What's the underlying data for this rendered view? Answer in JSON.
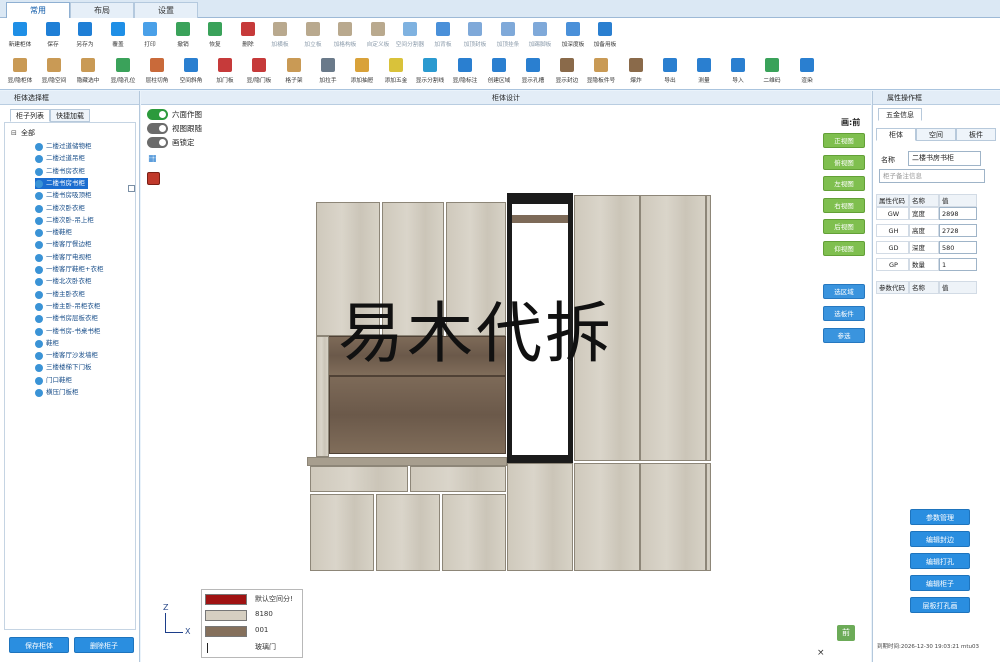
{
  "tabs": [
    "常用",
    "布局",
    "设置"
  ],
  "ribbon_row1": [
    {
      "label": "新建柜体",
      "color": "#1f8fe6",
      "dim": false
    },
    {
      "label": "保存",
      "color": "#1f7fd6",
      "dim": false
    },
    {
      "label": "另存为",
      "color": "#1f7fd6",
      "dim": false
    },
    {
      "label": "覆盖",
      "color": "#1f8fe6",
      "dim": false
    },
    {
      "label": "打印",
      "color": "#4aa0e8",
      "dim": false
    },
    {
      "label": "撤销",
      "color": "#3aa25a",
      "dim": false
    },
    {
      "label": "恢复",
      "color": "#3aa25a",
      "dim": false
    },
    {
      "label": "删除",
      "color": "#c63a3a",
      "dim": false
    },
    {
      "label": "加横板",
      "color": "#b9a98e",
      "dim": true
    },
    {
      "label": "加立板",
      "color": "#b9a98e",
      "dim": true
    },
    {
      "label": "加格构板",
      "color": "#b9a98e",
      "dim": true
    },
    {
      "label": "自定义板",
      "color": "#b9a98e",
      "dim": true
    },
    {
      "label": "空间分割器",
      "color": "#7fb2e0",
      "dim": true
    },
    {
      "label": "加背板",
      "color": "#4a90d9",
      "dim": true
    },
    {
      "label": "加顶封板",
      "color": "#7fa9d9",
      "dim": true
    },
    {
      "label": "加顶挂条",
      "color": "#7fa9d9",
      "dim": true
    },
    {
      "label": "加踢脚板",
      "color": "#7fa9d9",
      "dim": true
    },
    {
      "label": "加深度板",
      "color": "#4a90d9",
      "dim": false
    },
    {
      "label": "加备用板",
      "color": "#2a7fd0",
      "dim": false
    }
  ],
  "ribbon_row2": [
    {
      "label": "显/隐柜体",
      "color": "#c99a55"
    },
    {
      "label": "显/隐空间",
      "color": "#c99a55"
    },
    {
      "label": "隐藏选中",
      "color": "#c99a55"
    },
    {
      "label": "显/隐孔位",
      "color": "#3aa25a"
    },
    {
      "label": "层柱切角",
      "color": "#c96a3a"
    },
    {
      "label": "空间斜角",
      "color": "#2a7fd0"
    },
    {
      "label": "加门板",
      "color": "#c63a3a"
    },
    {
      "label": "显/隐门板",
      "color": "#c63a3a"
    },
    {
      "label": "格子架",
      "color": "#c99a55"
    },
    {
      "label": "加拉手",
      "color": "#6a7a8a"
    },
    {
      "label": "添加抽屉",
      "color": "#d9a23a"
    },
    {
      "label": "添加五金",
      "color": "#d9c23a"
    },
    {
      "label": "显示分割线",
      "color": "#2a9ad0"
    },
    {
      "label": "显/隐标注",
      "color": "#2a7fd0"
    },
    {
      "label": "创建区域",
      "color": "#2a7fd0"
    },
    {
      "label": "显示孔槽",
      "color": "#2a7fd0"
    },
    {
      "label": "显示封边",
      "color": "#8a6a4a"
    },
    {
      "label": "显隐板件号",
      "color": "#c99a55"
    },
    {
      "label": "爆炸",
      "color": "#8a6a4a"
    },
    {
      "label": "导出",
      "color": "#2a7fd0"
    },
    {
      "label": "测量",
      "color": "#2a7fd0"
    },
    {
      "label": "导入",
      "color": "#2a7fd0"
    },
    {
      "label": "二维码",
      "color": "#3aa25a"
    },
    {
      "label": "渲染",
      "color": "#2a7fd0"
    }
  ],
  "left_panel": {
    "title": "柜体选择框",
    "tabs": [
      "柜子列表",
      "快捷加载"
    ],
    "root": "全部",
    "items": [
      "二楼过道储物柜",
      "二楼过道吊柜",
      "二楼书房衣柜",
      "二楼书房书柜",
      "二楼书房吸顶柜",
      "二楼次卧衣柜",
      "二楼次卧-吊上柜",
      "一楼鞋柜",
      "一楼客厅餐边柜",
      "一楼客厅电视柜",
      "一楼客厅鞋柜+衣柜",
      "一楼北次卧衣柜",
      "一楼主卧衣柜",
      "一楼主卧-吊柜衣柜",
      "一楼书房层板衣柜",
      "一楼书房-书桌书柜",
      "鞋柜",
      "一楼客厅沙发墙柜",
      "三楼楼梯下门板",
      "门口鞋柜",
      "横压门板柜"
    ],
    "selected_index": 3,
    "btn_save": "保存柜体",
    "btn_delete": "删除柜子"
  },
  "center": {
    "title": "柜体设计",
    "toggles": [
      {
        "label": "六面作图",
        "on": true
      },
      {
        "label": "视图跟随",
        "on": false
      },
      {
        "label": "画锁定",
        "on": false
      }
    ],
    "view_label": "画:前",
    "view_buttons": [
      "正视图",
      "俯视图",
      "左视图",
      "右视图",
      "后视图",
      "仰视图"
    ],
    "action_buttons": [
      "选区域",
      "选板件",
      "参选"
    ],
    "watermark": "易木代拆",
    "axis_z": "Z",
    "axis_x": "X",
    "cube_label": "前",
    "close_x": "×"
  },
  "legend": [
    {
      "color": "#a01212",
      "label": "默认空间分!"
    },
    {
      "color": "#d6cfc1",
      "label": "8180"
    },
    {
      "color": "#85705c",
      "label": "001"
    },
    {
      "color": "#ffffff",
      "label": "玻璃门"
    }
  ],
  "right_panel": {
    "title": "属性操作框",
    "tab_top": "五金信息",
    "tabs": [
      "柜体",
      "空间",
      "板件"
    ],
    "name_label": "名称",
    "name_value": "二楼书房书柜",
    "placeholder": "柜子备注信息",
    "props_header": [
      "属性代码",
      "名称",
      "值"
    ],
    "props": [
      {
        "code": "GW",
        "name": "宽度",
        "value": "2898"
      },
      {
        "code": "GH",
        "name": "高度",
        "value": "2728"
      },
      {
        "code": "GD",
        "name": "深度",
        "value": "580"
      },
      {
        "code": "GP",
        "name": "数量",
        "value": "1"
      }
    ],
    "params_header": [
      "参数代码",
      "名称",
      "值"
    ],
    "buttons": [
      "参数管理",
      "编辑封边",
      "编辑打孔",
      "编辑柜子",
      "层板打孔画"
    ],
    "status": "到期时间:2026-12-30 19:03:21 mtu03"
  }
}
